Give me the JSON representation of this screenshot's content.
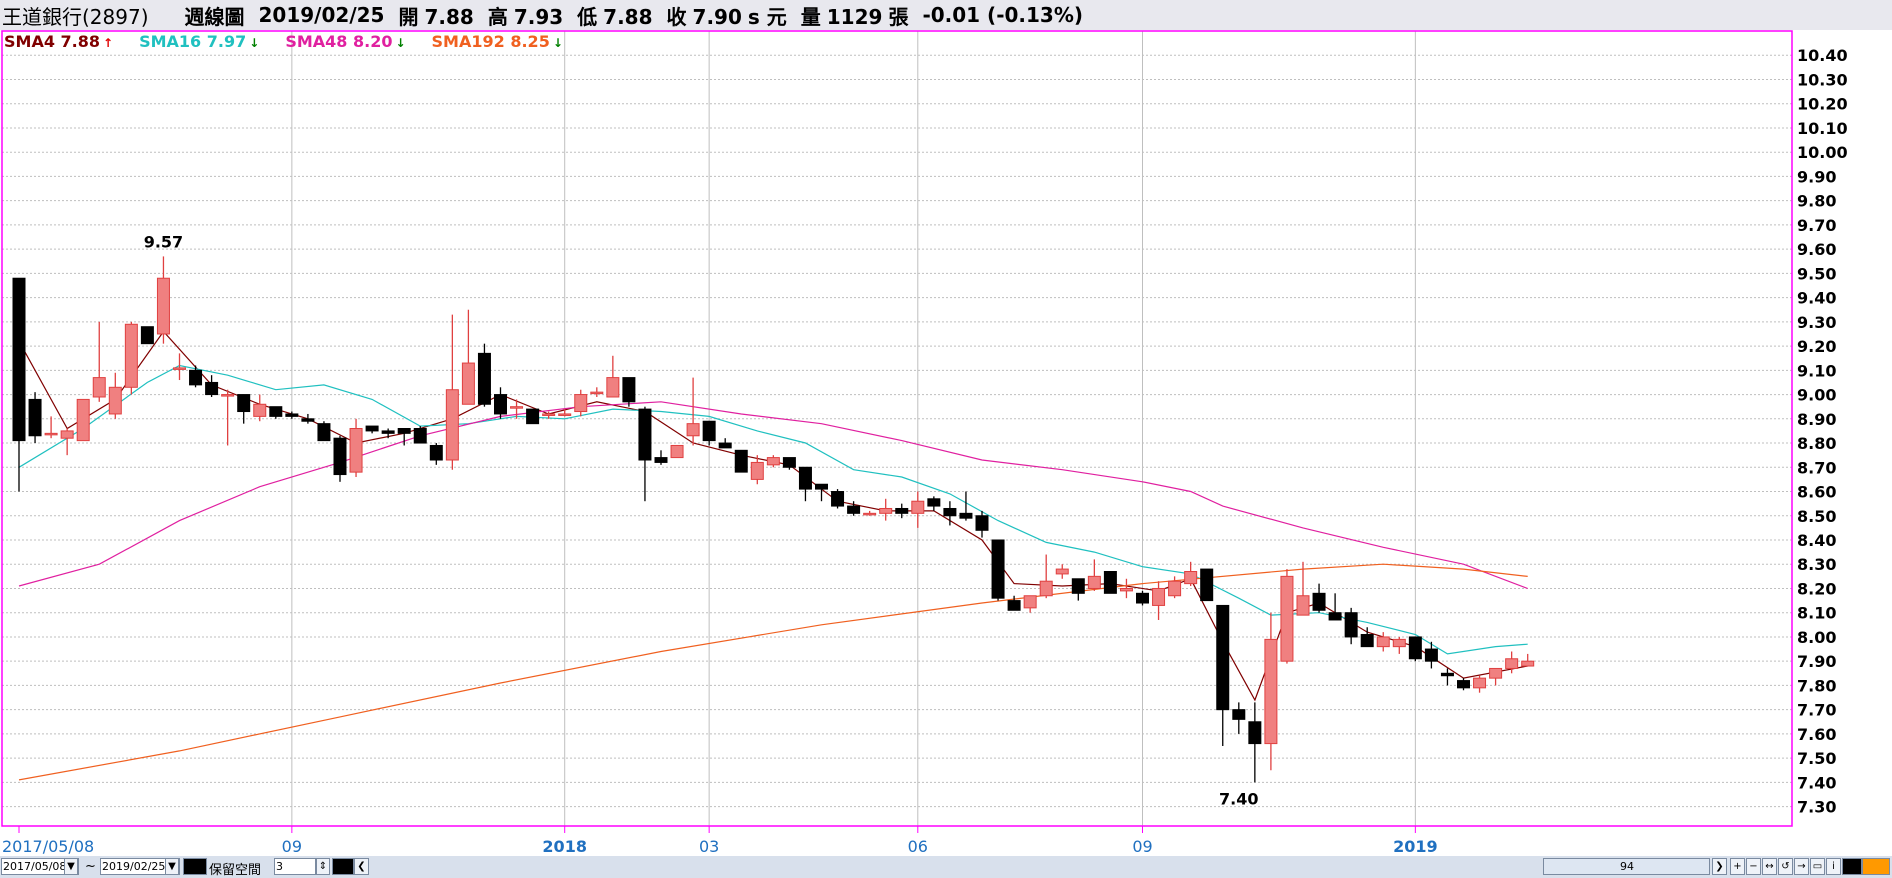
{
  "header": {
    "stock": "王道銀行(2897)",
    "period": "週線圖",
    "date": "2019/02/25",
    "open_label": "開",
    "open": "7.88",
    "high_label": "高",
    "high": "7.93",
    "low_label": "低",
    "low": "7.88",
    "close_label": "收",
    "close": "7.90",
    "unit": "s 元",
    "volume_label": "量",
    "volume": "1129",
    "volume_unit": "張",
    "change": "-0.01 (-0.13%)"
  },
  "legend": [
    {
      "label": "SMA4",
      "value": "7.88",
      "arrow": "↑",
      "color": "#800000",
      "arrow_color": "#e00000"
    },
    {
      "label": "SMA16",
      "value": "7.97",
      "arrow": "↓",
      "color": "#20c0c0",
      "arrow_color": "#008000"
    },
    {
      "label": "SMA48",
      "value": "8.20",
      "arrow": "↓",
      "color": "#e020a0",
      "arrow_color": "#008000"
    },
    {
      "label": "SMA192",
      "value": "8.25",
      "arrow": "↓",
      "color": "#f06020",
      "arrow_color": "#008000"
    }
  ],
  "controls": {
    "start_date": "2017/05/08",
    "end_date": "2019/02/25",
    "tilde": "~",
    "reserve_label": "保留空間",
    "reserve_value": "3",
    "scroll_value": "94"
  },
  "colors": {
    "up_fill": "#f08080",
    "up_edge": "#e04040",
    "down": "#000000",
    "grid": "#bfbfbf",
    "frame": "#ff00ff"
  },
  "chart_data": {
    "type": "candlestick",
    "ylim": [
      7.22,
      10.5
    ],
    "yticks": [
      "10.40",
      "10.30",
      "10.20",
      "10.10",
      "10.00",
      "9.90",
      "9.80",
      "9.70",
      "9.60",
      "9.50",
      "9.40",
      "9.30",
      "9.20",
      "9.10",
      "9.00",
      "8.90",
      "8.80",
      "8.70",
      "8.60",
      "8.50",
      "8.40",
      "8.30",
      "8.20",
      "8.10",
      "8.00",
      "7.90",
      "7.80",
      "7.70",
      "7.60",
      "7.50",
      "7.40",
      "7.30"
    ],
    "xticks": [
      {
        "label": "2017/05/08",
        "index": 0,
        "bold": false
      },
      {
        "label": "09",
        "index": 17,
        "bold": false
      },
      {
        "label": "2018",
        "index": 34,
        "bold": true
      },
      {
        "label": "03",
        "index": 43,
        "bold": false
      },
      {
        "label": "06",
        "index": 56,
        "bold": false
      },
      {
        "label": "09",
        "index": 70,
        "bold": false
      },
      {
        "label": "2019",
        "index": 87,
        "bold": true
      }
    ],
    "annotations": [
      {
        "text": "9.57",
        "index": 9,
        "value": 9.57,
        "pos": "above"
      },
      {
        "text": "7.40",
        "index": 76,
        "value": 7.4,
        "pos": "below"
      }
    ],
    "ohlc": [
      [
        9.48,
        9.48,
        8.6,
        8.81
      ],
      [
        8.98,
        9.01,
        8.8,
        8.83
      ],
      [
        8.84,
        8.91,
        8.82,
        8.84
      ],
      [
        8.82,
        8.86,
        8.75,
        8.85
      ],
      [
        8.81,
        8.98,
        8.81,
        8.98
      ],
      [
        8.99,
        9.3,
        8.97,
        9.07
      ],
      [
        8.92,
        9.09,
        8.9,
        9.03
      ],
      [
        9.03,
        9.3,
        9.0,
        9.29
      ],
      [
        9.28,
        9.28,
        9.21,
        9.21
      ],
      [
        9.25,
        9.57,
        9.21,
        9.48
      ],
      [
        9.11,
        9.17,
        9.06,
        9.11
      ],
      [
        9.1,
        9.12,
        9.03,
        9.04
      ],
      [
        9.05,
        9.08,
        8.99,
        9.0
      ],
      [
        9.0,
        9.02,
        8.79,
        9.0
      ],
      [
        9.0,
        9.0,
        8.88,
        8.93
      ],
      [
        8.91,
        9.0,
        8.89,
        8.96
      ],
      [
        8.95,
        8.95,
        8.9,
        8.91
      ],
      [
        8.92,
        8.93,
        8.9,
        8.91
      ],
      [
        8.9,
        8.92,
        8.88,
        8.89
      ],
      [
        8.88,
        8.89,
        8.82,
        8.81
      ],
      [
        8.82,
        8.83,
        8.64,
        8.67
      ],
      [
        8.68,
        8.9,
        8.66,
        8.86
      ],
      [
        8.87,
        8.87,
        8.84,
        8.85
      ],
      [
        8.85,
        8.86,
        8.82,
        8.84
      ],
      [
        8.86,
        8.86,
        8.79,
        8.84
      ],
      [
        8.86,
        8.87,
        8.84,
        8.8
      ],
      [
        8.79,
        8.8,
        8.71,
        8.73
      ],
      [
        8.73,
        9.33,
        8.69,
        9.02
      ],
      [
        8.96,
        9.35,
        8.96,
        9.13
      ],
      [
        9.17,
        9.21,
        8.95,
        8.96
      ],
      [
        9.0,
        9.03,
        8.9,
        8.92
      ],
      [
        8.95,
        8.98,
        8.9,
        8.95
      ],
      [
        8.94,
        8.94,
        8.89,
        8.88
      ],
      [
        8.92,
        8.93,
        8.9,
        8.92
      ],
      [
        8.92,
        8.94,
        8.91,
        8.92
      ],
      [
        8.93,
        9.02,
        8.91,
        9.0
      ],
      [
        9.01,
        9.03,
        8.99,
        9.01
      ],
      [
        8.99,
        9.16,
        8.99,
        9.07
      ],
      [
        9.07,
        9.07,
        8.95,
        8.97
      ],
      [
        8.94,
        8.95,
        8.56,
        8.73
      ],
      [
        8.74,
        8.77,
        8.71,
        8.72
      ],
      [
        8.74,
        8.79,
        8.74,
        8.79
      ],
      [
        8.83,
        9.07,
        8.79,
        8.88
      ],
      [
        8.89,
        8.89,
        8.79,
        8.81
      ],
      [
        8.8,
        8.82,
        8.79,
        8.78
      ],
      [
        8.77,
        8.77,
        8.68,
        8.68
      ],
      [
        8.65,
        8.75,
        8.63,
        8.72
      ],
      [
        8.71,
        8.75,
        8.7,
        8.74
      ],
      [
        8.74,
        8.74,
        8.69,
        8.7
      ],
      [
        8.7,
        8.7,
        8.56,
        8.61
      ],
      [
        8.63,
        8.63,
        8.56,
        8.61
      ],
      [
        8.6,
        8.61,
        8.53,
        8.54
      ],
      [
        8.54,
        8.56,
        8.5,
        8.51
      ],
      [
        8.51,
        8.52,
        8.5,
        8.51
      ],
      [
        8.51,
        8.57,
        8.48,
        8.53
      ],
      [
        8.53,
        8.55,
        8.49,
        8.51
      ],
      [
        8.51,
        8.6,
        8.45,
        8.56
      ],
      [
        8.57,
        8.58,
        8.52,
        8.54
      ],
      [
        8.53,
        8.56,
        8.46,
        8.5
      ],
      [
        8.51,
        8.6,
        8.48,
        8.49
      ],
      [
        8.5,
        8.52,
        8.41,
        8.44
      ],
      [
        8.4,
        8.4,
        8.15,
        8.16
      ],
      [
        8.15,
        8.17,
        8.11,
        8.11
      ],
      [
        8.12,
        8.17,
        8.1,
        8.17
      ],
      [
        8.17,
        8.34,
        8.16,
        8.23
      ],
      [
        8.26,
        8.3,
        8.24,
        8.28
      ],
      [
        8.24,
        8.24,
        8.15,
        8.18
      ],
      [
        8.2,
        8.32,
        8.19,
        8.25
      ],
      [
        8.27,
        8.27,
        8.18,
        8.18
      ],
      [
        8.19,
        8.24,
        8.16,
        8.2
      ],
      [
        8.18,
        8.19,
        8.13,
        8.14
      ],
      [
        8.13,
        8.23,
        8.07,
        8.2
      ],
      [
        8.17,
        8.25,
        8.16,
        8.23
      ],
      [
        8.22,
        8.31,
        8.21,
        8.27
      ],
      [
        8.28,
        8.28,
        8.15,
        8.15
      ],
      [
        8.13,
        8.13,
        7.55,
        7.7
      ],
      [
        7.7,
        7.73,
        7.6,
        7.66
      ],
      [
        7.65,
        7.73,
        7.4,
        7.56
      ],
      [
        7.56,
        8.1,
        7.45,
        7.99
      ],
      [
        7.9,
        8.28,
        7.89,
        8.25
      ],
      [
        8.09,
        8.31,
        8.09,
        8.17
      ],
      [
        8.18,
        8.22,
        8.1,
        8.11
      ],
      [
        8.1,
        8.18,
        8.07,
        8.07
      ],
      [
        8.1,
        8.12,
        7.97,
        8.0
      ],
      [
        8.01,
        8.04,
        7.96,
        7.96
      ],
      [
        7.96,
        8.02,
        7.94,
        8.0
      ],
      [
        7.96,
        8.0,
        7.93,
        7.99
      ],
      [
        8.0,
        8.0,
        7.9,
        7.91
      ],
      [
        7.95,
        7.98,
        7.87,
        7.9
      ],
      [
        7.85,
        7.87,
        7.8,
        7.84
      ],
      [
        7.82,
        7.83,
        7.78,
        7.79
      ],
      [
        7.79,
        7.84,
        7.77,
        7.83
      ],
      [
        7.83,
        7.87,
        7.8,
        7.87
      ],
      [
        7.87,
        7.94,
        7.85,
        7.91
      ],
      [
        7.88,
        7.93,
        7.88,
        7.9
      ]
    ],
    "series": [
      {
        "label": "SMA4",
        "color": "#800000",
        "points": [
          [
            0,
            9.22
          ],
          [
            3,
            8.86
          ],
          [
            6,
            8.98
          ],
          [
            9,
            9.26
          ],
          [
            12,
            9.04
          ],
          [
            15,
            8.96
          ],
          [
            18,
            8.9
          ],
          [
            21,
            8.8
          ],
          [
            24,
            8.84
          ],
          [
            27,
            8.9
          ],
          [
            30,
            9.0
          ],
          [
            33,
            8.92
          ],
          [
            36,
            8.97
          ],
          [
            39,
            8.93
          ],
          [
            42,
            8.8
          ],
          [
            45,
            8.75
          ],
          [
            48,
            8.71
          ],
          [
            51,
            8.56
          ],
          [
            54,
            8.52
          ],
          [
            57,
            8.52
          ],
          [
            60,
            8.4
          ],
          [
            62,
            8.22
          ],
          [
            65,
            8.21
          ],
          [
            68,
            8.22
          ],
          [
            71,
            8.19
          ],
          [
            73,
            8.24
          ],
          [
            75,
            7.98
          ],
          [
            77,
            7.74
          ],
          [
            79,
            8.1
          ],
          [
            81,
            8.14
          ],
          [
            84,
            8.02
          ],
          [
            87,
            7.96
          ],
          [
            90,
            7.83
          ],
          [
            94,
            7.88
          ]
        ]
      },
      {
        "label": "SMA16",
        "color": "#20c0c0",
        "points": [
          [
            0,
            8.7
          ],
          [
            4,
            8.86
          ],
          [
            8,
            9.05
          ],
          [
            10,
            9.12
          ],
          [
            13,
            9.08
          ],
          [
            16,
            9.02
          ],
          [
            19,
            9.04
          ],
          [
            22,
            8.98
          ],
          [
            25,
            8.87
          ],
          [
            28,
            8.88
          ],
          [
            31,
            8.91
          ],
          [
            34,
            8.9
          ],
          [
            37,
            8.94
          ],
          [
            40,
            8.93
          ],
          [
            43,
            8.91
          ],
          [
            46,
            8.85
          ],
          [
            49,
            8.8
          ],
          [
            52,
            8.69
          ],
          [
            55,
            8.66
          ],
          [
            58,
            8.59
          ],
          [
            61,
            8.48
          ],
          [
            64,
            8.39
          ],
          [
            67,
            8.35
          ],
          [
            70,
            8.29
          ],
          [
            73,
            8.26
          ],
          [
            76,
            8.16
          ],
          [
            78,
            8.09
          ],
          [
            81,
            8.1
          ],
          [
            84,
            8.06
          ],
          [
            87,
            8.01
          ],
          [
            89,
            7.93
          ],
          [
            92,
            7.96
          ],
          [
            94,
            7.97
          ]
        ]
      },
      {
        "label": "SMA48",
        "color": "#e020a0",
        "points": [
          [
            0,
            8.21
          ],
          [
            5,
            8.3
          ],
          [
            10,
            8.48
          ],
          [
            15,
            8.62
          ],
          [
            20,
            8.72
          ],
          [
            25,
            8.83
          ],
          [
            30,
            8.91
          ],
          [
            35,
            8.95
          ],
          [
            40,
            8.97
          ],
          [
            45,
            8.92
          ],
          [
            50,
            8.88
          ],
          [
            55,
            8.81
          ],
          [
            60,
            8.73
          ],
          [
            65,
            8.69
          ],
          [
            70,
            8.64
          ],
          [
            73,
            8.6
          ],
          [
            75,
            8.54
          ],
          [
            80,
            8.45
          ],
          [
            85,
            8.37
          ],
          [
            90,
            8.3
          ],
          [
            94,
            8.2
          ]
        ]
      },
      {
        "label": "SMA192",
        "color": "#f06020",
        "points": [
          [
            0,
            7.41
          ],
          [
            10,
            7.53
          ],
          [
            20,
            7.67
          ],
          [
            30,
            7.81
          ],
          [
            40,
            7.94
          ],
          [
            50,
            8.05
          ],
          [
            60,
            8.14
          ],
          [
            70,
            8.22
          ],
          [
            80,
            8.28
          ],
          [
            85,
            8.3
          ],
          [
            90,
            8.28
          ],
          [
            94,
            8.25
          ]
        ]
      }
    ]
  }
}
